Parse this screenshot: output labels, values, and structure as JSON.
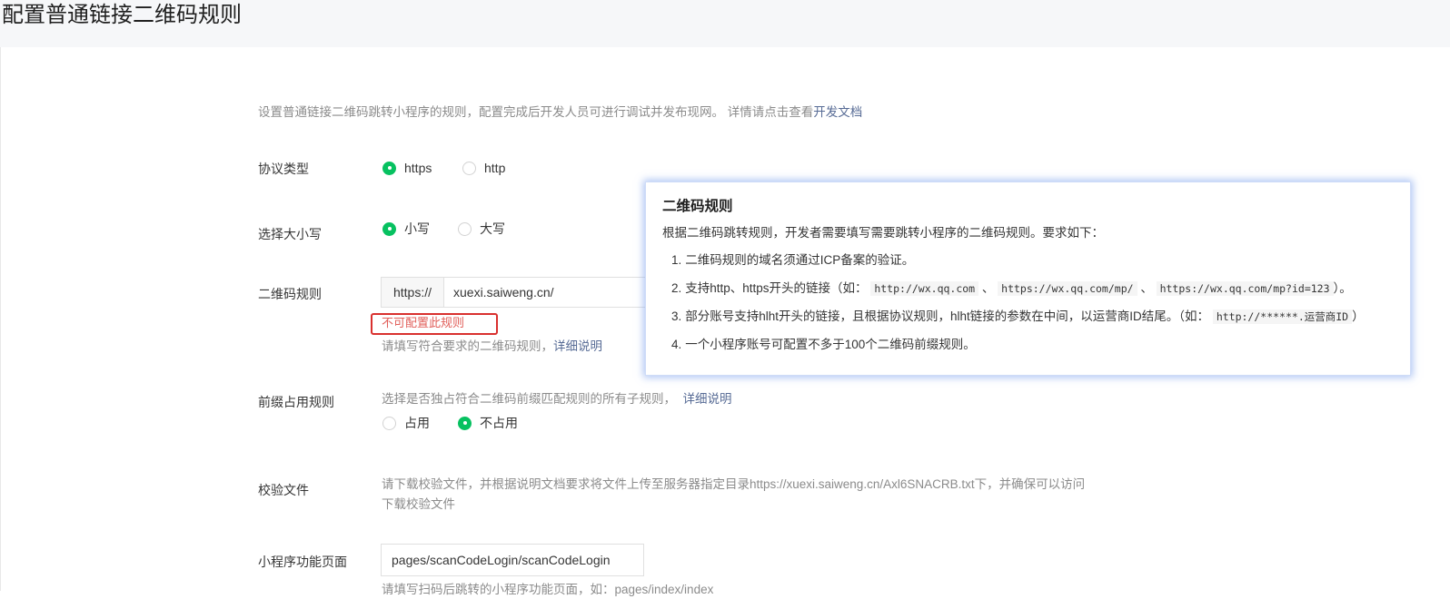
{
  "page": {
    "title": "配置普通链接二维码规则",
    "description": "设置普通链接二维码跳转小程序的规则，配置完成后开发人员可进行调试并发布现网。 详情请点击查看",
    "description_link": "开发文档"
  },
  "form": {
    "protocol": {
      "label": "协议类型",
      "options": [
        {
          "label": "https",
          "checked": true
        },
        {
          "label": "http",
          "checked": false
        }
      ]
    },
    "case": {
      "label": "选择大小写",
      "options": [
        {
          "label": "小写",
          "checked": true
        },
        {
          "label": "大写",
          "checked": false
        }
      ]
    },
    "qr_rule": {
      "label": "二维码规则",
      "prefix": "https://",
      "value": "xuexi.saiweng.cn/",
      "error": "不可配置此规则",
      "hint": "请填写符合要求的二维码规则，",
      "hint_link": "详细说明"
    },
    "prefix_rule": {
      "label": "前缀占用规则",
      "hint": "选择是否独占符合二维码前缀匹配规则的所有子规则，",
      "hint_link": "详细说明",
      "options": [
        {
          "label": "占用",
          "checked": false
        },
        {
          "label": "不占用",
          "checked": true
        }
      ]
    },
    "verify_file": {
      "label": "校验文件",
      "hint": "请下载校验文件，并根据说明文档要求将文件上传至服务器指定目录https://xuexi.saiweng.cn/Axl6SNACRB.txt下，并确保可以访问",
      "download_link": "下载校验文件"
    },
    "mini_page": {
      "label": "小程序功能页面",
      "value": "pages/scanCodeLogin/scanCodeLogin",
      "hint": "请填写扫码后跳转的小程序功能页面，如：pages/index/index"
    }
  },
  "popover": {
    "title": "二维码规则",
    "intro": "根据二维码跳转规则，开发者需要填写需要跳转小程序的二维码规则。要求如下：",
    "items": {
      "i1": {
        "num": "1.",
        "text": "二维码规则的域名须通过ICP备案的验证。"
      },
      "i2": {
        "num": "2.",
        "text_a": "支持http、https开头的链接（如：",
        "code1": "http://wx.qq.com",
        "sep1": "、",
        "code2": "https://wx.qq.com/mp/",
        "sep2": "、",
        "code3": "https://wx.qq.com/mp?id=123",
        "text_b": "）。"
      },
      "i3": {
        "num": "3.",
        "text_a": "部分账号支持hlht开头的链接，且根据协议规则，hlht链接的参数在中间，以运营商ID结尾。（如：",
        "code": "http://******.运营商ID",
        "text_b": "）"
      },
      "i4": {
        "num": "4.",
        "text": "一个小程序账号可配置不多于100个二维码前缀规则。"
      }
    }
  },
  "colors": {
    "primary_green": "#07c160",
    "link": "#576b95",
    "error": "#e15f5a",
    "error_outline": "#d9302e",
    "popover_glow": "#6e96eb"
  }
}
